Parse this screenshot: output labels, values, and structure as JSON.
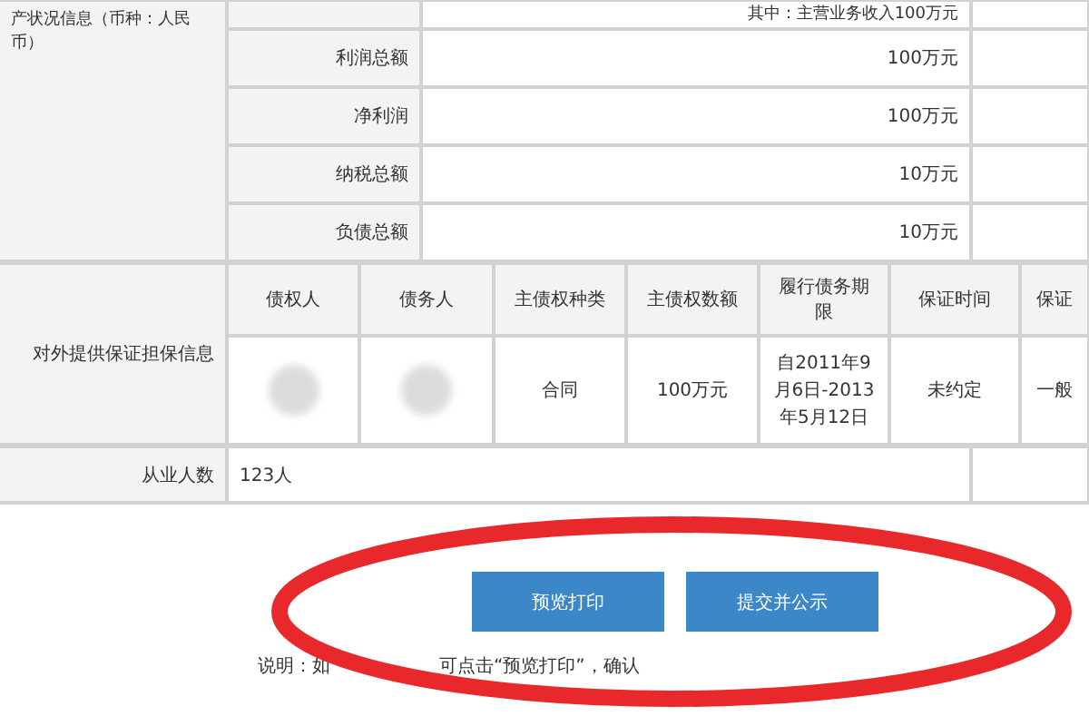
{
  "asset_section": {
    "label": "产状况信息（币种：人民币）",
    "note_row": "其中：主营业务收入100万元",
    "rows": [
      {
        "label": "利润总额",
        "value": "100万元"
      },
      {
        "label": "净利润",
        "value": "100万元"
      },
      {
        "label": "纳税总额",
        "value": "10万元"
      },
      {
        "label": "负债总额",
        "value": "10万元"
      }
    ]
  },
  "guarantee_section": {
    "label": "对外提供保证担保信息",
    "columns": [
      "债权人",
      "债务人",
      "主债权种类",
      "主债权数额",
      "履行债务期限",
      "保证时间",
      "保证"
    ],
    "rows": [
      {
        "cells": [
          {
            "kind": "blurred"
          },
          {
            "kind": "blurred"
          },
          {
            "kind": "text",
            "text": "合同"
          },
          {
            "kind": "text",
            "text": "100万元"
          },
          {
            "kind": "text",
            "text": "自2011年9月6日-2013年5月12日"
          },
          {
            "kind": "text",
            "text": "未约定"
          },
          {
            "kind": "text",
            "text": "一般"
          }
        ]
      }
    ]
  },
  "employees": {
    "label": "从业人数",
    "value": "123人"
  },
  "buttons": [
    {
      "label": "预览打印"
    },
    {
      "label": "提交并公示"
    }
  ],
  "note": [
    "说明：如",
    "可点击“预览打印”，确认"
  ]
}
